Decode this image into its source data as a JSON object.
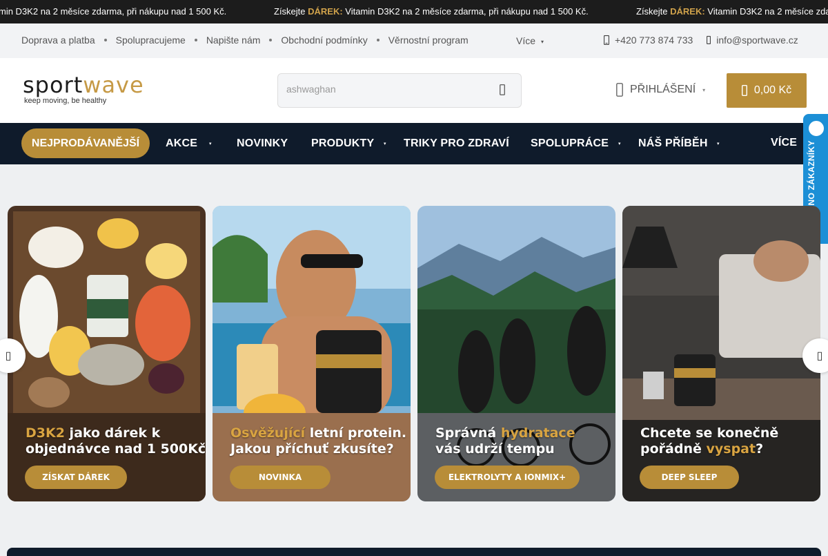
{
  "promo": {
    "messages": [
      {
        "prefix": "",
        "highlight": "",
        "text": "min D3K2 na 2 měsíce zdarma, při nákupu nad 1 500 Kč."
      },
      {
        "prefix": "Získejte ",
        "highlight": "DÁREK:",
        "text": " Vitamin D3K2 na 2 měsíce zdarma, při nákupu nad 1 500 Kč."
      },
      {
        "prefix": "Získejte ",
        "highlight": "DÁREK:",
        "text": " Vitamin D3K2 na 2 měsíce zdarma, při nákupu nad 1 500 Kč."
      }
    ]
  },
  "top_links": [
    "Doprava a platba",
    "Spolupracujeme",
    "Napište nám",
    "Obchodní podmínky",
    "Věrnostní program"
  ],
  "top_more": "Více",
  "contact": {
    "phone": "+420 773 874 733",
    "email": "info@sportwave.cz"
  },
  "logo": {
    "word1": "sport",
    "word2": "wave",
    "tagline": "keep moving, be healthy"
  },
  "search": {
    "value": "ashwaghan"
  },
  "login_label": "PŘIHLÁŠENÍ",
  "cart_total": "0,00 Kč",
  "nav": {
    "highlight": "NEJPRODÁVANĚJŠÍ",
    "items": [
      "AKCE",
      "NOVINKY",
      "PRODUKTY",
      "TRIKY PRO ZDRAVÍ",
      "SPOLUPRÁCE",
      "NÁŠ PŘÍBĚH",
      "VÍCE"
    ]
  },
  "badge": "OVĚŘENO ZÁKAZNÍKY",
  "banners": [
    {
      "hl": "D3K2",
      "rest1": " jako dárek k",
      "line2": "objednávce nad 1 500Kč",
      "button": "ZÍSKAT DÁREK"
    },
    {
      "hl": "Osvěžující",
      "rest1": " letní protein.",
      "line2": "Jakou příchuť zkusíte?",
      "button": "NOVINKA"
    },
    {
      "pre": "Správná ",
      "hl": "hydratace",
      "line2": "vás udrží tempu",
      "button": "ELEKTROLYTY A IONMIX+"
    },
    {
      "line1": "Chcete se konečně",
      "pre2": "pořádně ",
      "hl": "vyspat",
      "post2": "?",
      "button": "DEEP SLEEP"
    }
  ],
  "colors": {
    "accent": "#b88d38",
    "nav_bg": "#0f1b2b",
    "badge_bg": "#1c8fd6"
  }
}
